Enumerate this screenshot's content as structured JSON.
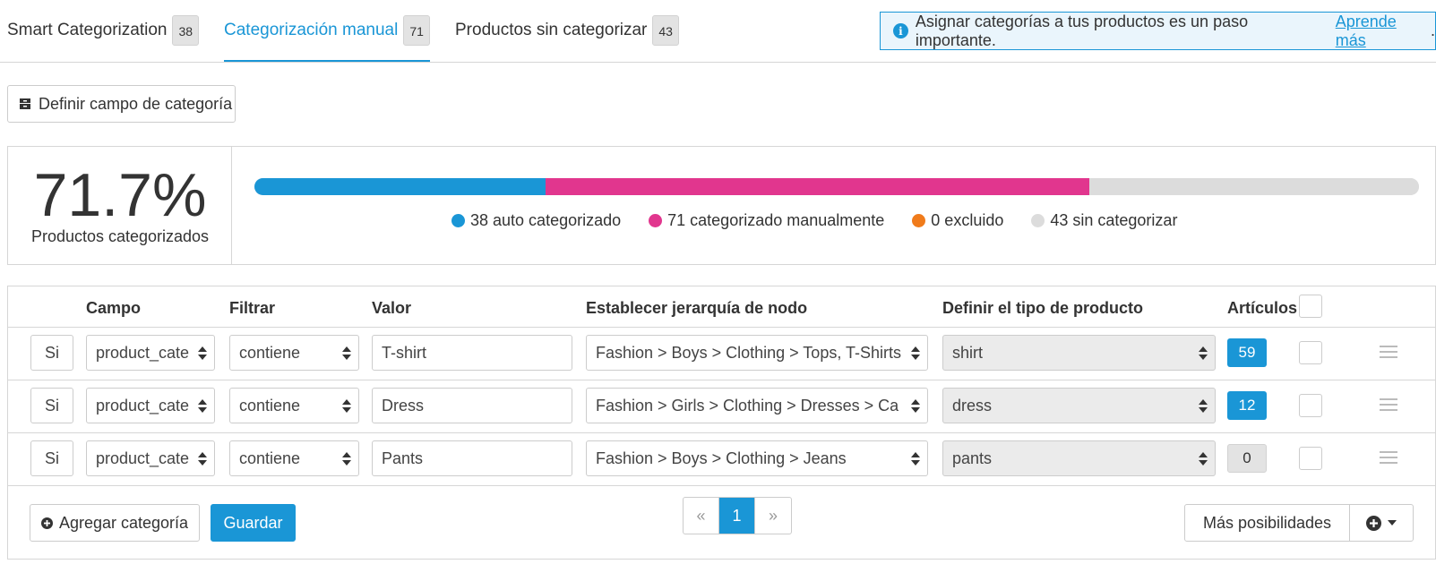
{
  "tabs": [
    {
      "label": "Smart Categorization",
      "count": "38"
    },
    {
      "label": "Categorización manual",
      "count": "71"
    },
    {
      "label": "Productos sin categorizar",
      "count": "43"
    }
  ],
  "info": {
    "text": "Asignar categorías a tus productos es un paso importante.",
    "link": "Aprende más",
    "suffix": "."
  },
  "define_button": "Definir campo de categoría",
  "summary": {
    "percent": "71.7%",
    "label": "Productos categorizados",
    "bar": [
      {
        "fraction": 0.25,
        "color": "#1a96d6"
      },
      {
        "fraction": 0.467,
        "color": "#e1368e"
      },
      {
        "fraction": 0.0,
        "color": "#f07b1b"
      },
      {
        "fraction": 0.283,
        "color": "#dcdcdc"
      }
    ],
    "legend": [
      {
        "text": "38 auto categorizado",
        "color": "#1a96d6"
      },
      {
        "text": "71 categorizado manualmente",
        "color": "#e1368e"
      },
      {
        "text": "0 excluido",
        "color": "#f07b1b"
      },
      {
        "text": "43 sin categorizar",
        "color": "#dcdcdc"
      }
    ]
  },
  "table": {
    "headers": {
      "campo": "Campo",
      "filtrar": "Filtrar",
      "valor": "Valor",
      "jerarquia": "Establecer jerarquía de nodo",
      "tipo": "Definir el tipo de producto",
      "articulos": "Artículos"
    },
    "rows": [
      {
        "si": "Si",
        "campo": "product_cate",
        "filtro": "contiene",
        "valor": "T-shirt",
        "jerarquia": "Fashion > Boys > Clothing > Tops, T-Shirts",
        "tipo": "shirt",
        "count": "59",
        "count_active": true
      },
      {
        "si": "Si",
        "campo": "product_cate",
        "filtro": "contiene",
        "valor": "Dress",
        "jerarquia": "Fashion > Girls > Clothing > Dresses > Ca",
        "tipo": "dress",
        "count": "12",
        "count_active": true
      },
      {
        "si": "Si",
        "campo": "product_cate",
        "filtro": "contiene",
        "valor": "Pants",
        "jerarquia": "Fashion > Boys > Clothing > Jeans",
        "tipo": "pants",
        "count": "0",
        "count_active": false
      }
    ]
  },
  "footer": {
    "add_label": "Agregar categoría",
    "save_label": "Guardar",
    "pager": {
      "prev": "«",
      "current": "1",
      "next": "»"
    },
    "more_label": "Más posibilidades"
  },
  "colors": {
    "accent": "#1a96d6",
    "manual": "#e1368e",
    "excluded": "#f07b1b",
    "uncategorized": "#dcdcdc"
  }
}
